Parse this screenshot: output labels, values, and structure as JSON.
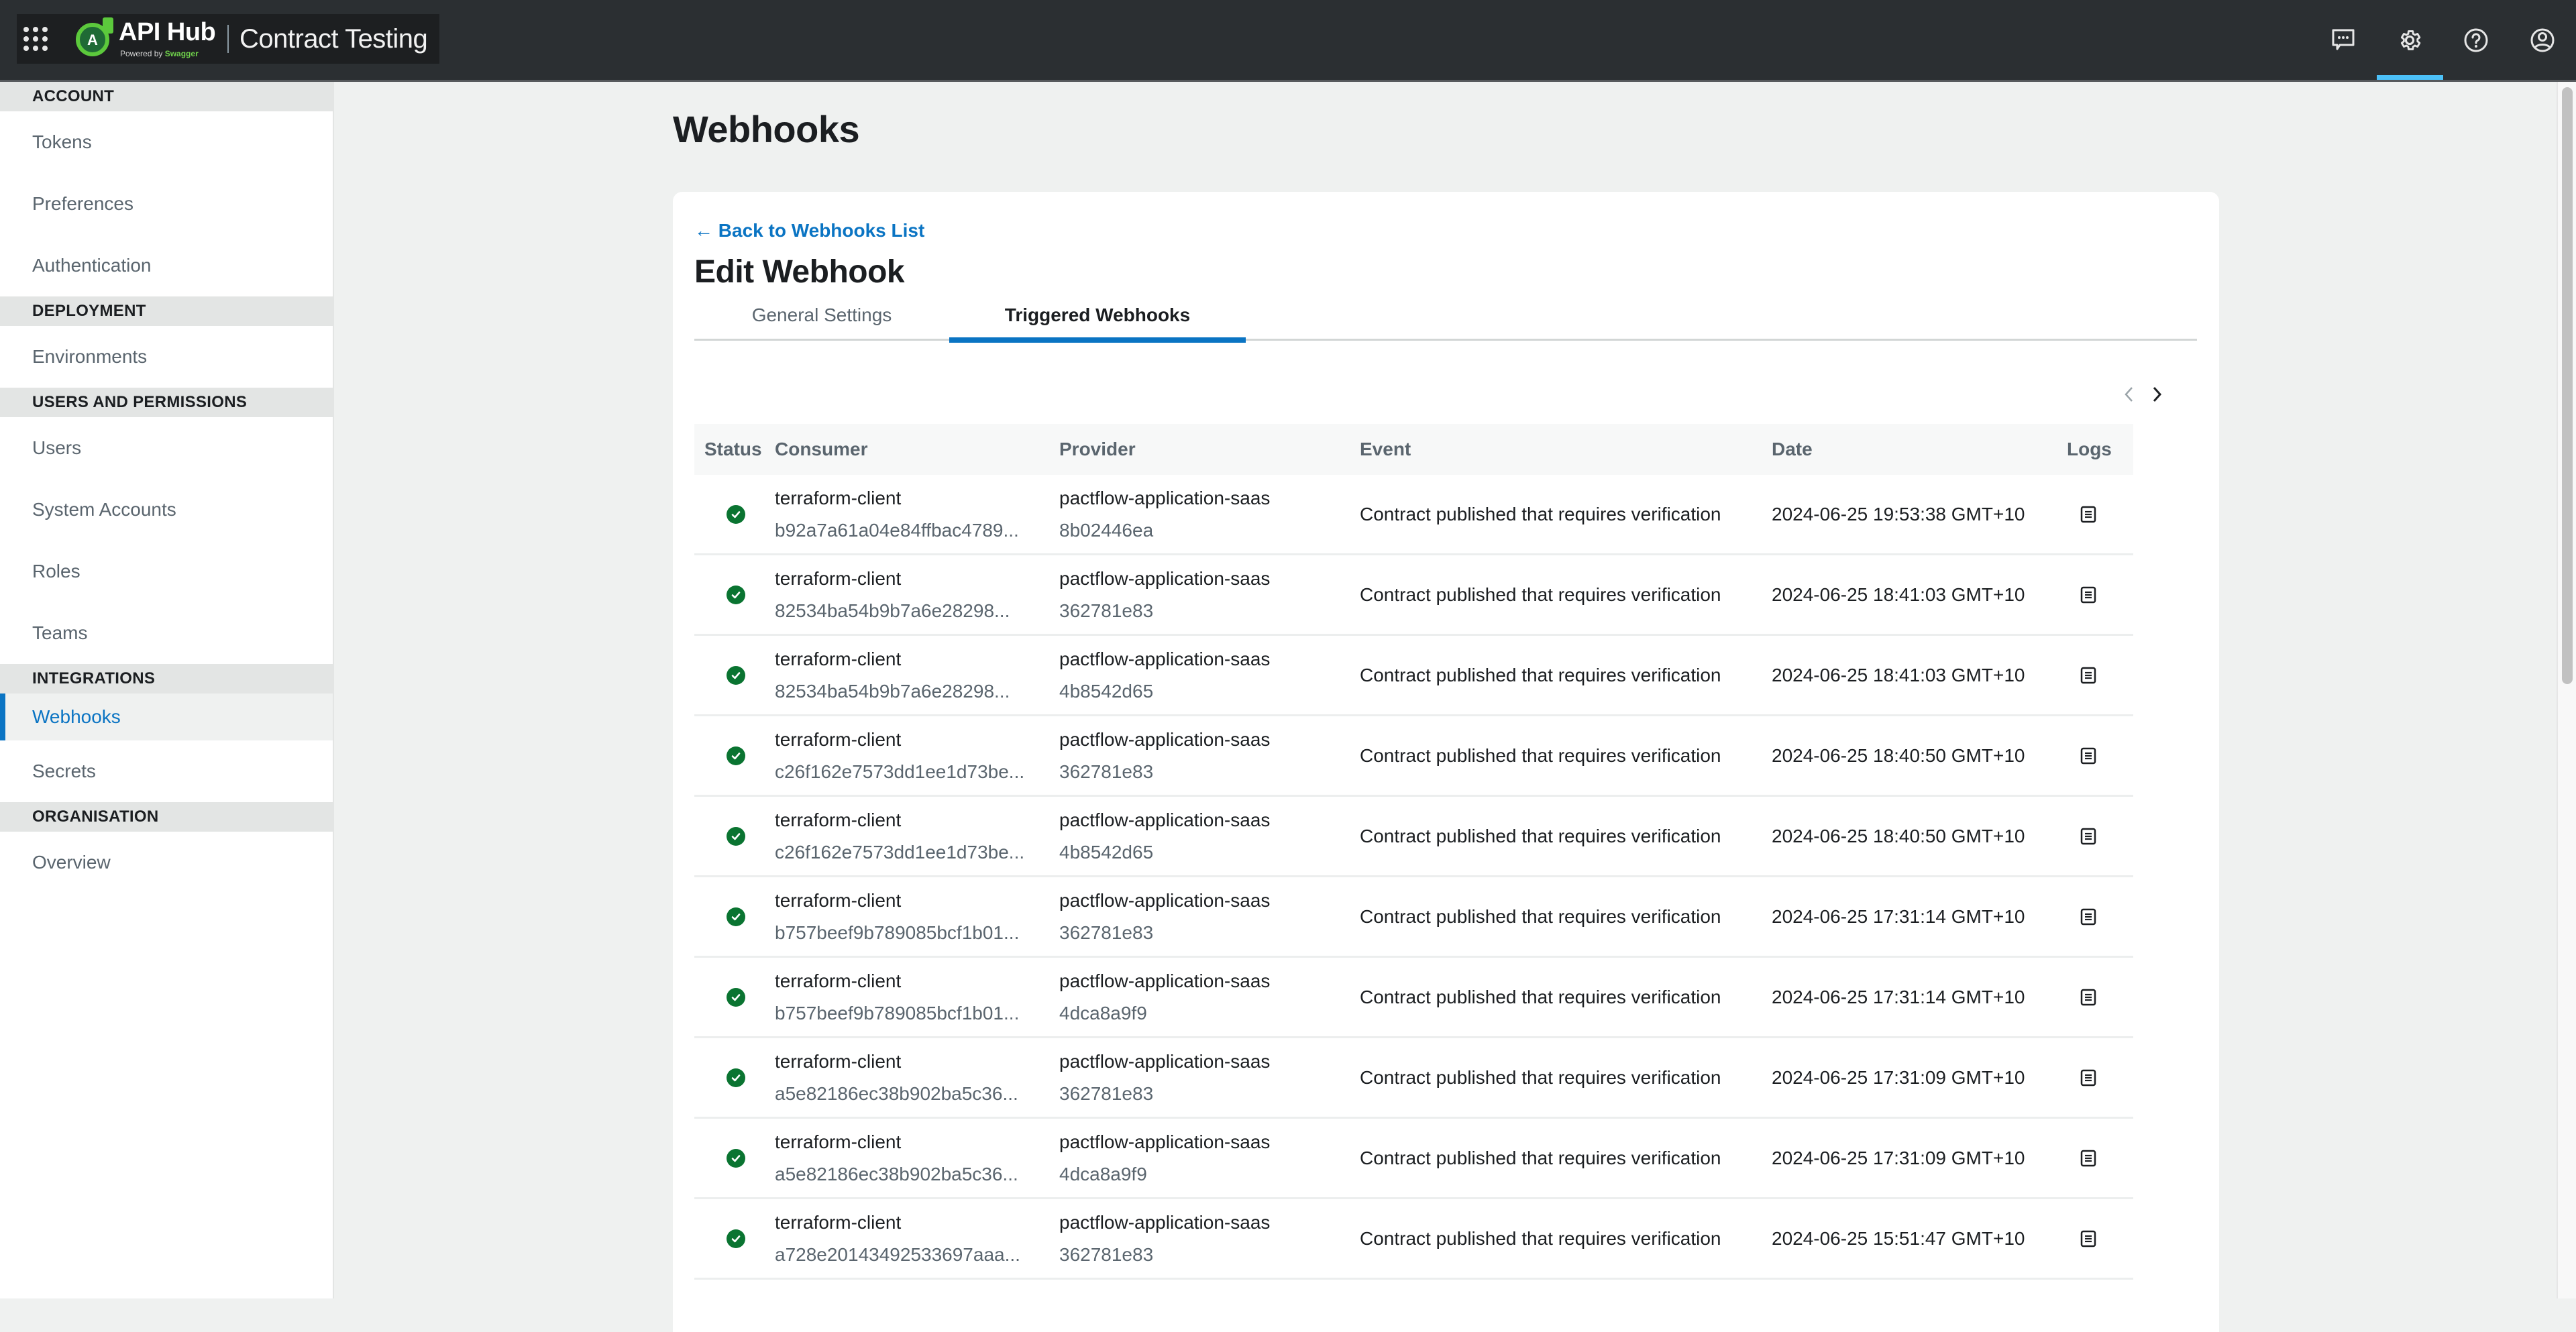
{
  "header": {
    "brand_name": "API Hub",
    "brand_powered_prefix": "Powered by",
    "brand_powered_name": "Swagger",
    "product_name": "Contract Testing",
    "logo_letter": "A",
    "icons": [
      "apps-grid-icon",
      "feedback-chat-icon",
      "settings-gear-icon",
      "help-question-icon",
      "user-account-icon"
    ],
    "active_icon": "settings-gear-icon",
    "colors": {
      "bar_bg": "#2b2f32",
      "active_underline": "#4cc1f8",
      "brand_green": "#5cc93c"
    }
  },
  "sidebar": {
    "sections": [
      {
        "title": "ACCOUNT",
        "items": [
          {
            "label": "Tokens"
          },
          {
            "label": "Preferences"
          },
          {
            "label": "Authentication"
          }
        ]
      },
      {
        "title": "DEPLOYMENT",
        "items": [
          {
            "label": "Environments"
          }
        ]
      },
      {
        "title": "USERS AND PERMISSIONS",
        "items": [
          {
            "label": "Users"
          },
          {
            "label": "System Accounts"
          },
          {
            "label": "Roles"
          },
          {
            "label": "Teams"
          }
        ]
      },
      {
        "title": "INTEGRATIONS",
        "items": [
          {
            "label": "Webhooks",
            "active": true
          },
          {
            "label": "Secrets"
          }
        ]
      },
      {
        "title": "ORGANISATION",
        "items": [
          {
            "label": "Overview"
          }
        ]
      }
    ],
    "active_color": "#0a74c3"
  },
  "main": {
    "page_title": "Webhooks",
    "back_link": "← Back to Webhooks List",
    "card_title": "Edit Webhook",
    "tabs": [
      {
        "label": "General Settings",
        "active": false
      },
      {
        "label": "Triggered Webhooks",
        "active": true
      }
    ],
    "pagination": {
      "prev_icon": "chevron-left-icon",
      "next_icon": "chevron-right-icon",
      "prev_disabled": true
    },
    "table": {
      "columns": [
        "Status",
        "Consumer",
        "Provider",
        "Event",
        "Date",
        "Logs"
      ],
      "rows": [
        {
          "status": "success",
          "consumer": "terraform-client",
          "consumer_version": "b92a7a61a04e84ffbac4789...",
          "provider": "pactflow-application-saas",
          "provider_version": "8b02446ea",
          "event": "Contract published that requires verification",
          "date": "2024-06-25 19:53:38 GMT+10"
        },
        {
          "status": "success",
          "consumer": "terraform-client",
          "consumer_version": "82534ba54b9b7a6e28298...",
          "provider": "pactflow-application-saas",
          "provider_version": "362781e83",
          "event": "Contract published that requires verification",
          "date": "2024-06-25 18:41:03 GMT+10"
        },
        {
          "status": "success",
          "consumer": "terraform-client",
          "consumer_version": "82534ba54b9b7a6e28298...",
          "provider": "pactflow-application-saas",
          "provider_version": "4b8542d65",
          "event": "Contract published that requires verification",
          "date": "2024-06-25 18:41:03 GMT+10"
        },
        {
          "status": "success",
          "consumer": "terraform-client",
          "consumer_version": "c26f162e7573dd1ee1d73be...",
          "provider": "pactflow-application-saas",
          "provider_version": "362781e83",
          "event": "Contract published that requires verification",
          "date": "2024-06-25 18:40:50 GMT+10"
        },
        {
          "status": "success",
          "consumer": "terraform-client",
          "consumer_version": "c26f162e7573dd1ee1d73be...",
          "provider": "pactflow-application-saas",
          "provider_version": "4b8542d65",
          "event": "Contract published that requires verification",
          "date": "2024-06-25 18:40:50 GMT+10"
        },
        {
          "status": "success",
          "consumer": "terraform-client",
          "consumer_version": "b757beef9b789085bcf1b01...",
          "provider": "pactflow-application-saas",
          "provider_version": "362781e83",
          "event": "Contract published that requires verification",
          "date": "2024-06-25 17:31:14 GMT+10"
        },
        {
          "status": "success",
          "consumer": "terraform-client",
          "consumer_version": "b757beef9b789085bcf1b01...",
          "provider": "pactflow-application-saas",
          "provider_version": "4dca8a9f9",
          "event": "Contract published that requires verification",
          "date": "2024-06-25 17:31:14 GMT+10"
        },
        {
          "status": "success",
          "consumer": "terraform-client",
          "consumer_version": "a5e82186ec38b902ba5c36...",
          "provider": "pactflow-application-saas",
          "provider_version": "362781e83",
          "event": "Contract published that requires verification",
          "date": "2024-06-25 17:31:09 GMT+10"
        },
        {
          "status": "success",
          "consumer": "terraform-client",
          "consumer_version": "a5e82186ec38b902ba5c36...",
          "provider": "pactflow-application-saas",
          "provider_version": "4dca8a9f9",
          "event": "Contract published that requires verification",
          "date": "2024-06-25 17:31:09 GMT+10"
        },
        {
          "status": "success",
          "consumer": "terraform-client",
          "consumer_version": "a728e20143492533697aaa...",
          "provider": "pactflow-application-saas",
          "provider_version": "362781e83",
          "event": "Contract published that requires verification",
          "date": "2024-06-25 15:51:47 GMT+10"
        }
      ],
      "status_color": "#0a7431",
      "row_icon_logs": "document-log-icon"
    }
  }
}
